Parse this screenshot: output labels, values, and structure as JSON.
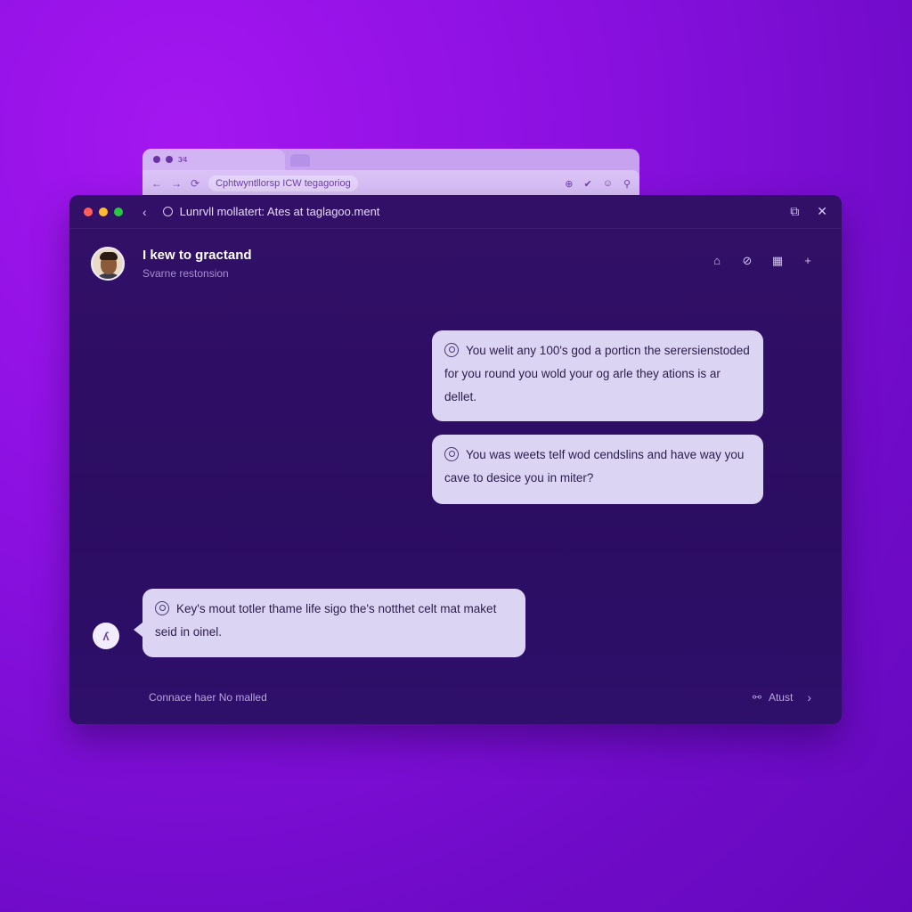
{
  "back_browser": {
    "tab_label": "3⁄4",
    "url": "Cphtwyntllorsp ICW tegagoriog",
    "nav_back": "←",
    "nav_forward": "→",
    "reload": "⟳",
    "icons": [
      "⊕",
      "✔",
      "☺",
      "⚲"
    ]
  },
  "window": {
    "back_glyph": "‹",
    "title": "Lunrvll mollatert: Ates at taglagoo.ment",
    "share_glyph": "⧉",
    "close_glyph": "✕"
  },
  "conversation": {
    "title": "I kew to gractand",
    "subtitle": "Svarne restonsion",
    "actions": [
      "⌂",
      "⊘",
      "▦",
      "+"
    ]
  },
  "messages": [
    {
      "text": "You welit any 100's god a porticn the serersienstoded for you round you wold your og arle they ations is ar dellet."
    },
    {
      "text": "You was weets telf wod cendslins and have way you cave to desice you in miter?"
    },
    {
      "text": "Key's mout totler thame life sigo the's notthet celt mat maket seid in oinel."
    }
  ],
  "bot_avatar_glyph": "ʎ",
  "footer": {
    "left": "Connace haer No malled",
    "right": "Atust",
    "link_glyph": "⚯",
    "chevron": "›"
  },
  "colors": {
    "background": "#8a10e0",
    "window": "#2b0d62",
    "bubble": "#dcd4f3"
  }
}
